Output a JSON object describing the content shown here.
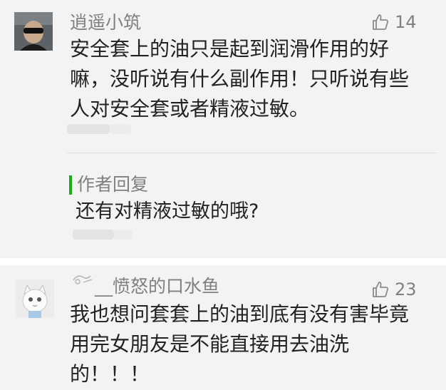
{
  "comments": [
    {
      "nickname": "逍遥小筑",
      "likes": "14",
      "body_lines": [
        "安全套上的油只是起到润滑作用的好",
        "嘛，没听说有什么副作用！只听说有些",
        "人对安全套或者精液过敏。"
      ],
      "reply": {
        "label": "作者回复",
        "text": "还有对精液过敏的哦?"
      }
    },
    {
      "nickname": "__愤怒的口水鱼",
      "likes": "23",
      "body_lines": [
        "我也想问套套上的油到底有没有害毕竟",
        "用完女朋友是不能直接用去油洗",
        "的！！！"
      ]
    }
  ],
  "colors": {
    "background": "#f3f3f3",
    "text": "#222222",
    "meta": "#808080",
    "reply_accent": "#1aad19"
  },
  "icons": {
    "like": "thumbs-up-icon",
    "nickname_badge": "nickname-badge-icon"
  }
}
